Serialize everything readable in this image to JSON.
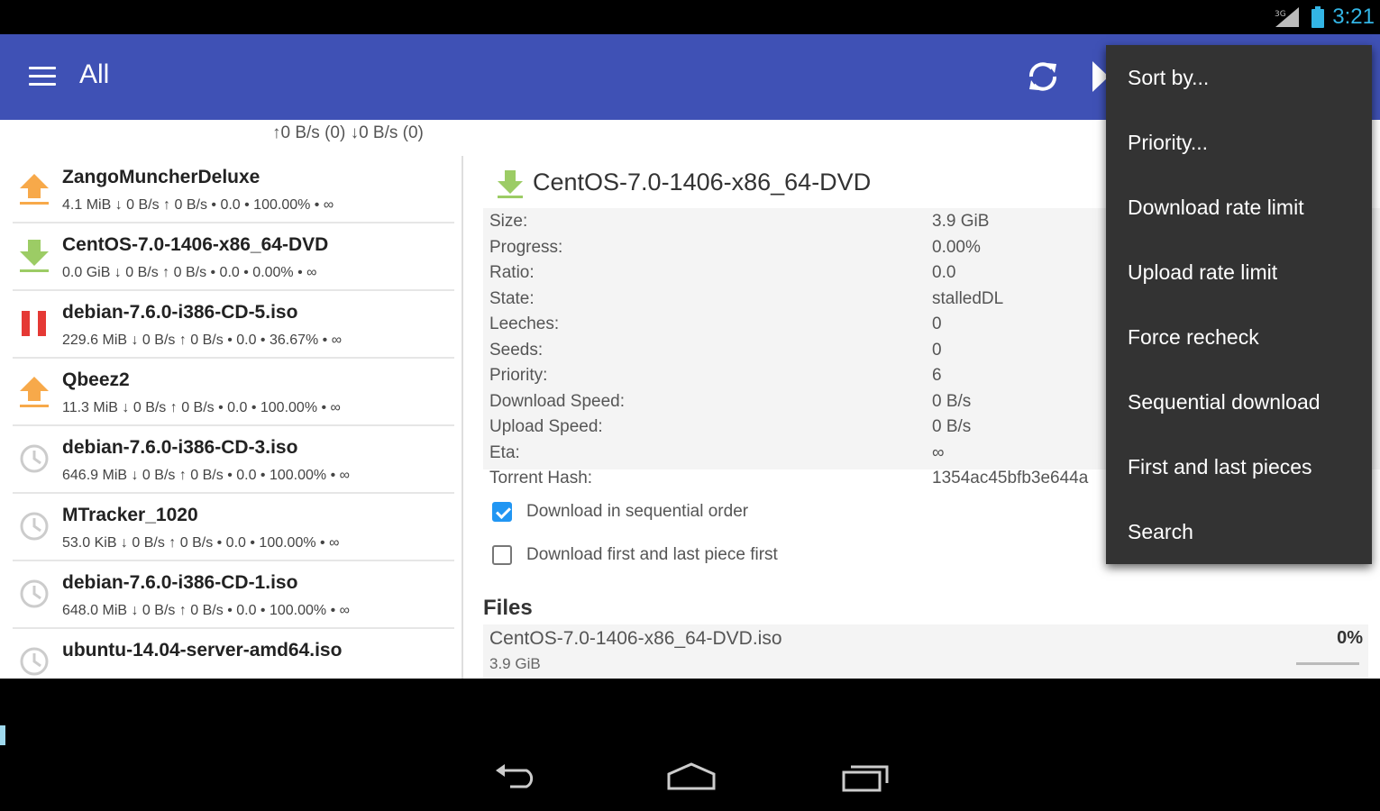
{
  "status_bar": {
    "time": "3:21"
  },
  "toolbar": {
    "title": "All"
  },
  "speed_summary": "↑0 B/s (0) ↓0 B/s (0)",
  "torrents": [
    {
      "name": "ZangoMuncherDeluxe",
      "info": "4.1 MiB ↓ 0 B/s ↑ 0 B/s • 0.0 • 100.00% • ∞",
      "state_icon": "upload-arrow-icon"
    },
    {
      "name": "CentOS-7.0-1406-x86_64-DVD",
      "info": "0.0 GiB ↓ 0 B/s ↑ 0 B/s • 0.0 • 0.00% • ∞",
      "state_icon": "download-arrow-icon"
    },
    {
      "name": "debian-7.6.0-i386-CD-5.iso",
      "info": "229.6 MiB ↓ 0 B/s ↑ 0 B/s • 0.0 • 36.67% • ∞",
      "state_icon": "pause-icon"
    },
    {
      "name": "Qbeez2",
      "info": "11.3 MiB ↓ 0 B/s ↑ 0 B/s • 0.0 • 100.00% • ∞",
      "state_icon": "upload-arrow-icon"
    },
    {
      "name": "debian-7.6.0-i386-CD-3.iso",
      "info": "646.9 MiB ↓ 0 B/s ↑ 0 B/s • 0.0 • 100.00% • ∞",
      "state_icon": "clock-icon"
    },
    {
      "name": "MTracker_1020",
      "info": "53.0 KiB ↓ 0 B/s ↑ 0 B/s • 0.0 • 100.00% • ∞",
      "state_icon": "clock-icon"
    },
    {
      "name": "debian-7.6.0-i386-CD-1.iso",
      "info": "648.0 MiB ↓ 0 B/s ↑ 0 B/s • 0.0 • 100.00% • ∞",
      "state_icon": "clock-icon"
    },
    {
      "name": "ubuntu-14.04-server-amd64.iso",
      "info": "",
      "state_icon": "clock-icon"
    }
  ],
  "detail": {
    "title": "CentOS-7.0-1406-x86_64-DVD",
    "properties": [
      {
        "label": "Size:",
        "value": "3.9 GiB"
      },
      {
        "label": "Progress:",
        "value": "0.00%"
      },
      {
        "label": "Ratio:",
        "value": "0.0"
      },
      {
        "label": "State:",
        "value": "stalledDL"
      },
      {
        "label": "Leeches:",
        "value": "0"
      },
      {
        "label": "Seeds:",
        "value": "0"
      },
      {
        "label": "Priority:",
        "value": "6"
      },
      {
        "label": "Download Speed:",
        "value": "0 B/s"
      },
      {
        "label": "Upload Speed:",
        "value": "0 B/s"
      },
      {
        "label": "Eta:",
        "value": "∞"
      },
      {
        "label": "Torrent Hash:",
        "value": "1354ac45bfb3e644a"
      }
    ],
    "sequential_label": "Download in sequential order",
    "sequential_checked": true,
    "first_last_label": "Download first and last piece first",
    "first_last_checked": false,
    "files_header": "Files",
    "files": [
      {
        "name": "CentOS-7.0-1406-x86_64-DVD.iso",
        "size": "3.9 GiB",
        "percent": "0%",
        "progress": 0
      }
    ]
  },
  "popup_menu": {
    "items": [
      "Sort by...",
      "Priority...",
      "Download rate limit",
      "Upload rate limit",
      "Force recheck",
      "Sequential download",
      "First and last pieces",
      "Search"
    ]
  },
  "colors": {
    "toolbar": "#3f51b5",
    "upload_icon": "#f7a94a",
    "download_icon": "#9ccc65",
    "pause_icon": "#e53935",
    "checkbox": "#2196f3",
    "clock_text": "#33b5e5"
  }
}
